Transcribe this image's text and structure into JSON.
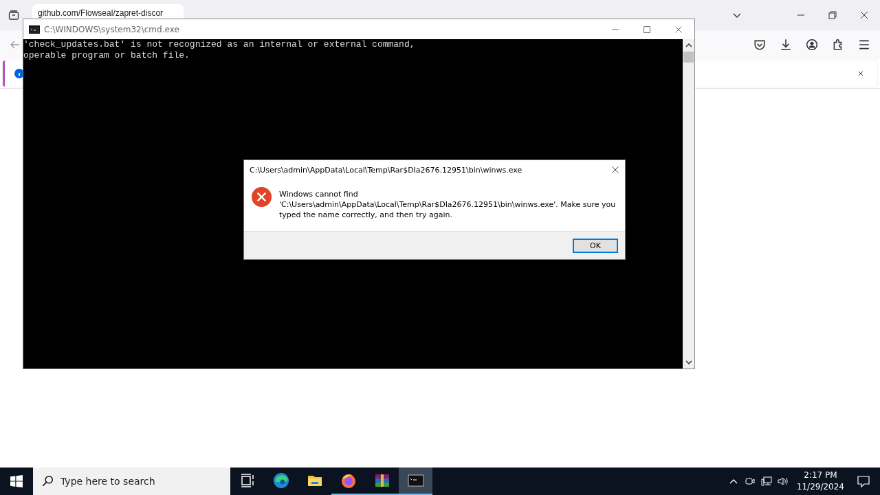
{
  "browser": {
    "tab": {
      "title": "github.com/Flowseal/zapret-discor"
    }
  },
  "console": {
    "title": "C:\\WINDOWS\\system32\\cmd.exe",
    "lines": [
      "'check_updates.bat' is not recognized as an internal or external command,",
      "operable program or batch file."
    ]
  },
  "dialog": {
    "title": "C:\\Users\\admin\\AppData\\Local\\Temp\\Rar$DIa2676.12951\\bin\\winws.exe",
    "message": [
      "Windows cannot find",
      "'C:\\Users\\admin\\AppData\\Local\\Temp\\Rar$DIa2676.12951\\bin\\winws.exe'. Make sure you",
      "typed the name correctly, and then try again."
    ],
    "button": "OK"
  },
  "taskbar": {
    "search": {
      "placeholder": "Type here to search"
    },
    "apps": [
      {
        "kind": "taskview",
        "running": false,
        "selected": false
      },
      {
        "kind": "edge",
        "running": false,
        "selected": false
      },
      {
        "kind": "folder",
        "running": false,
        "selected": false
      },
      {
        "kind": "firefox",
        "running": true,
        "selected": false
      },
      {
        "kind": "archive",
        "running": true,
        "selected": false
      },
      {
        "kind": "console",
        "running": true,
        "selected": true
      }
    ],
    "time": "2:17 PM",
    "date": "11/29/2024"
  }
}
